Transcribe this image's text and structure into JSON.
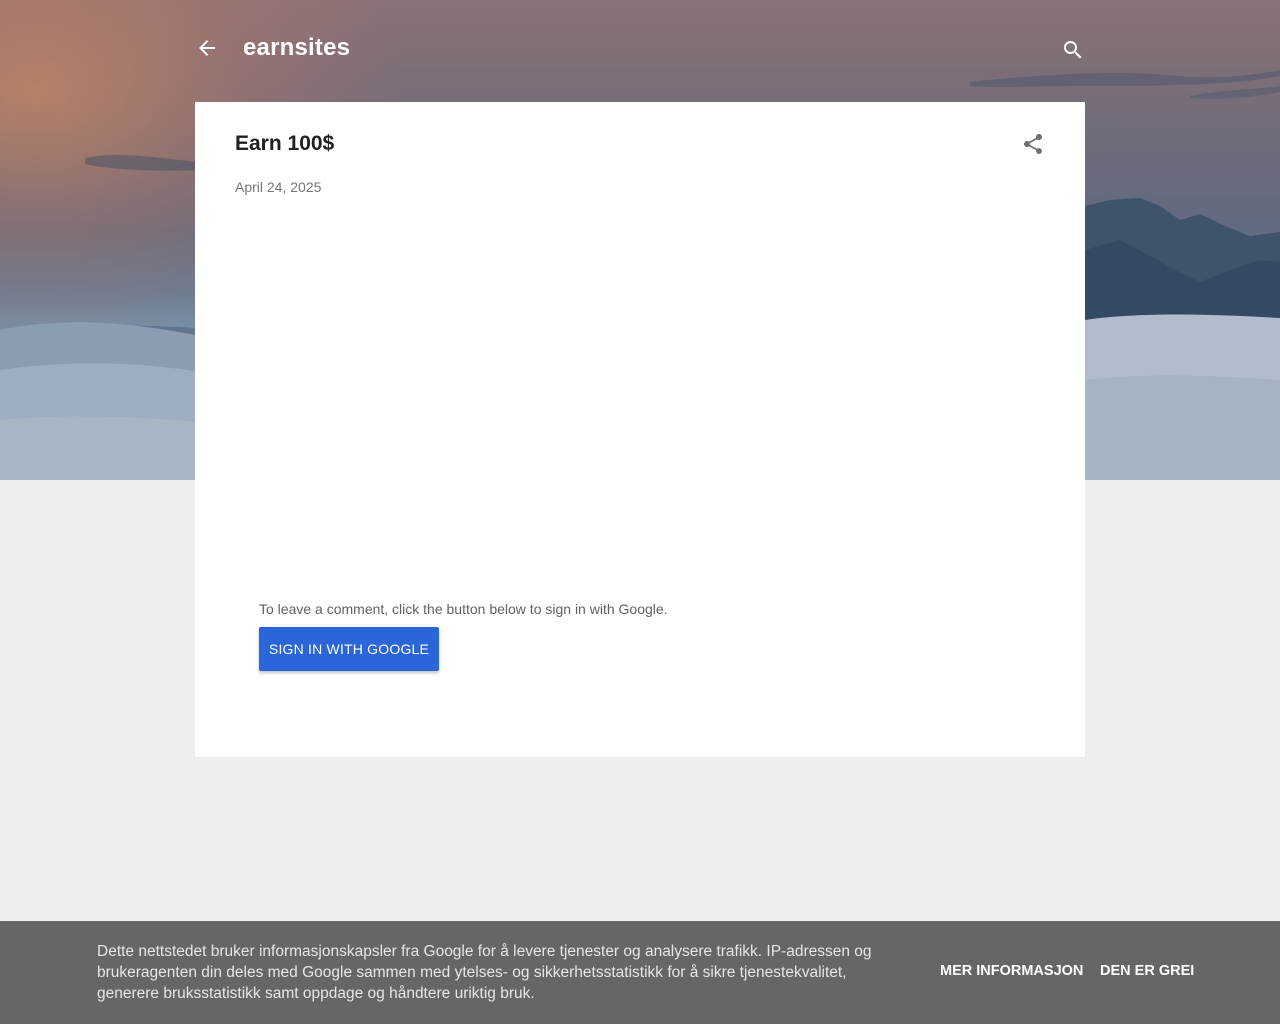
{
  "header": {
    "blog_title": "earnsites",
    "back_icon": "arrow-back-icon",
    "search_icon": "search-icon"
  },
  "post": {
    "title": "Earn 100$",
    "date": "April 24, 2025",
    "share_icon": "share-icon"
  },
  "comments": {
    "prompt": "To leave a comment, click the button below to sign in with Google.",
    "signin_label": "SIGN IN WITH GOOGLE"
  },
  "cookie_notice": {
    "text": "Dette nettstedet bruker informasjonskapsler fra Google for å levere tjenester og analysere trafikk. IP-adressen og brukeragenten din deles med Google sammen med ytelses- og sikkerhetsstatistikk for å sikre tjenestekvalitet, generere bruksstatistikk samt oppdage og håndtere uriktig bruk.",
    "more_label": "MER INFORMASJON",
    "ok_label": "DEN ER GREI"
  },
  "colors": {
    "page_background": "#eeeeee",
    "card_background": "#ffffff",
    "button_blue": "#2a66d9",
    "cookie_bar": "#666666",
    "title_text": "#212121",
    "meta_text": "#757575"
  }
}
